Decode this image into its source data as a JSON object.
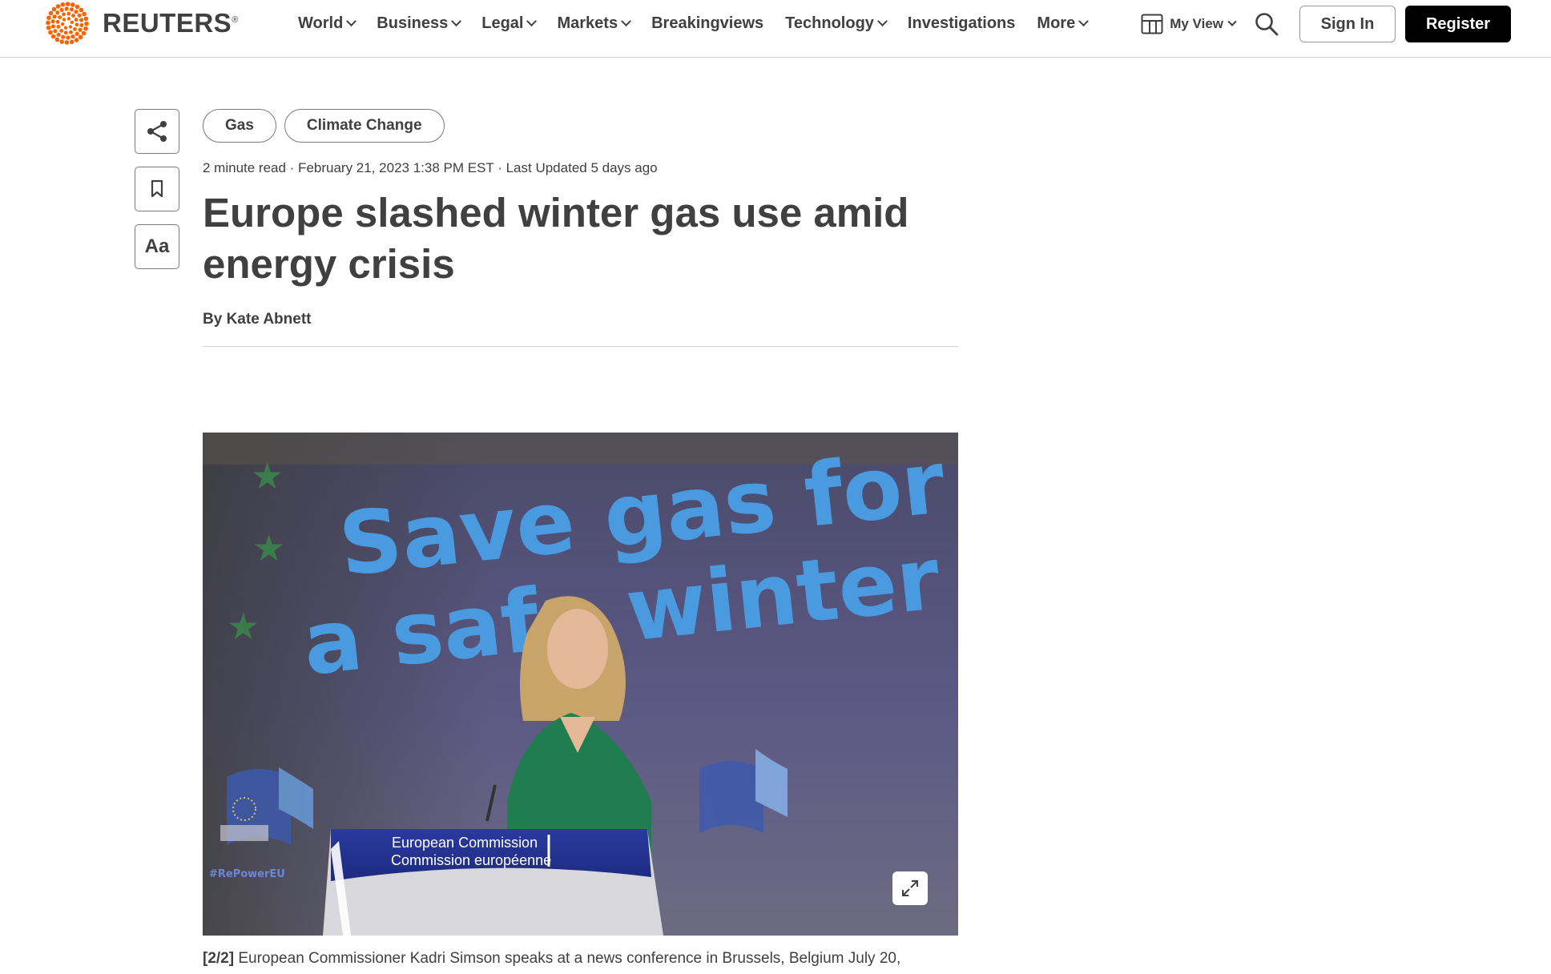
{
  "brand": {
    "name": "REUTERS",
    "registered": "®"
  },
  "nav": {
    "items": [
      {
        "label": "World",
        "dropdown": true
      },
      {
        "label": "Business",
        "dropdown": true
      },
      {
        "label": "Legal",
        "dropdown": true
      },
      {
        "label": "Markets",
        "dropdown": true
      },
      {
        "label": "Breakingviews",
        "dropdown": false
      },
      {
        "label": "Technology",
        "dropdown": true
      },
      {
        "label": "Investigations",
        "dropdown": false
      },
      {
        "label": "More",
        "dropdown": true
      }
    ]
  },
  "header_tools": {
    "my_view_label": "My View",
    "sign_in_label": "Sign In",
    "register_label": "Register"
  },
  "side_tools": {
    "font_label": "Aa"
  },
  "article": {
    "tags": [
      "Gas",
      "Climate Change"
    ],
    "meta": "2 minute read · February 21, 2023 1:38 PM EST · Last Updated 5 days ago",
    "headline": "Europe slashed winter gas use amid energy crisis",
    "byline_prefix": "By",
    "author": "Kate Abnett"
  },
  "photo": {
    "banner_line1": "Save gas for",
    "banner_line2": "a safe winter",
    "podium_line1": "European Commission",
    "podium_line2": "Commission européenne",
    "hashtag": "#RePowerEU"
  },
  "caption": {
    "index": "[2/2]",
    "text": "European Commissioner Kadri Simson speaks at a news conference in Brussels, Belgium July 20,"
  },
  "colors": {
    "brand_orange": "#fa6400",
    "text": "#404040",
    "register_bg": "#000000"
  }
}
